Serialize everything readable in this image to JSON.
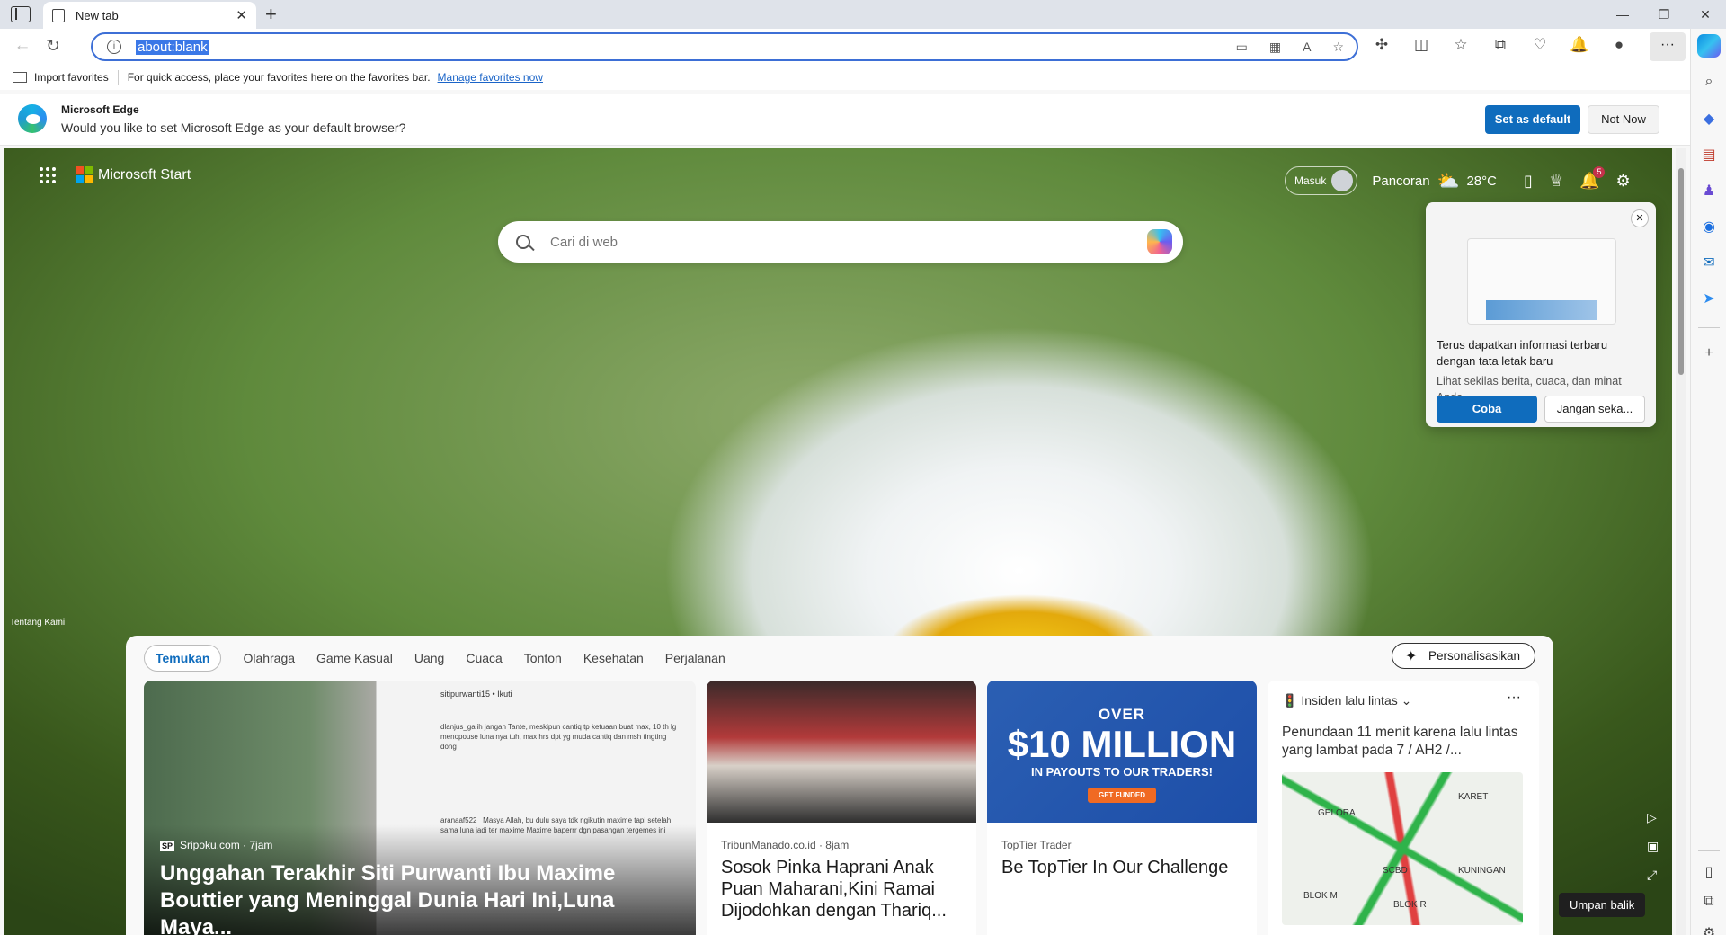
{
  "tab": {
    "title": "New tab",
    "close": "✕",
    "new": "+"
  },
  "window": {
    "minimize": "—",
    "restore": "❐",
    "close": "✕"
  },
  "address": {
    "url": "about:blank"
  },
  "favbar": {
    "import": "Import favorites",
    "message": "For quick access, place your favorites here on the favorites bar.",
    "manage_link": "Manage favorites now"
  },
  "banner": {
    "title": "Microsoft Edge",
    "message": "Would you like to set Microsoft Edge as your default browser?",
    "primary": "Set as default",
    "secondary": "Not Now"
  },
  "ntp": {
    "brand": "Microsoft Start",
    "sign_in": "Masuk",
    "location": "Pancoran",
    "temperature": "28°C",
    "notifications": "5",
    "search_placeholder": "Cari di web",
    "about": "Tentang Kami"
  },
  "popup": {
    "title": "Terus dapatkan informasi terbaru dengan tata letak baru",
    "desc": "Lihat sekilas berita, cuaca, dan minat Anda",
    "try": "Coba",
    "dismiss": "Jangan seka..."
  },
  "feed": {
    "tabs": [
      "Temukan",
      "Olahraga",
      "Game Kasual",
      "Uang",
      "Cuaca",
      "Tonton",
      "Kesehatan",
      "Perjalanan"
    ],
    "personalize": "Personalisasikan",
    "cards": [
      {
        "source": "Sripoku.com · 7jam",
        "source_badge": "SP",
        "title": "Unggahan Terakhir Siti Purwanti Ibu Maxime Bouttier yang Meninggal Dunia Hari Ini,Luna Maya...",
        "comment_user": "sitipurwanti15 • Ikuti",
        "comment_1": "dlanjus_galih jangan Tante, meskipun cantiq tp ketuaan buat max, 10 th lg menopouse luna nya tuh, max hrs dpt yg muda cantiq dan msh tingting dong",
        "comment_2": "aranaaf522_ Masya Allah, bu dulu saya tdk ngikutin maxime tapi setelah sama luna jadi ter maxime Maxime baperrr dgn pasangan tergemes ini"
      },
      {
        "source": "TribunManado.co.id · 8jam",
        "title": "Sosok Pinka Haprani Anak Puan Maharani,Kini Ramai Dijodohkan dengan Thariq..."
      },
      {
        "source": "TopTier Trader",
        "title": "Be TopTier In Our Challenge",
        "ad_over": "OVER",
        "ad_big": "$10 MILLION",
        "ad_sub": "IN PAYOUTS TO OUR TRADERS!",
        "ad_cta": "GET FUNDED"
      },
      {
        "header": "Insiden lalu lintas",
        "title": "Penundaan 11 menit karena lalu lintas yang lambat pada 7 / AH2 /...",
        "map_labels": [
          "GELORA",
          "KARET",
          "SCBD",
          "KUNINGAN",
          "BLOK R",
          "BLOK M"
        ]
      }
    ]
  },
  "feedback": "Umpan balik"
}
